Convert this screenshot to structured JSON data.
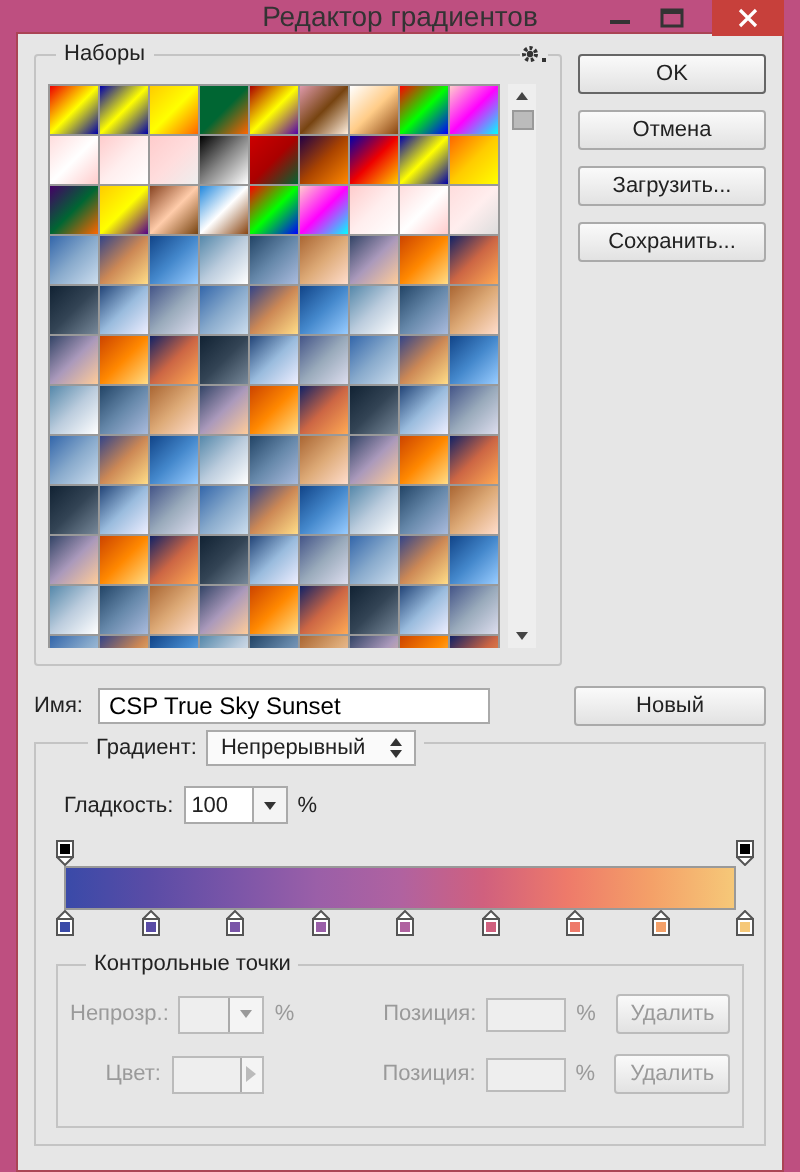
{
  "window": {
    "title": "Редактор градиентов"
  },
  "presets": {
    "label": "Наборы"
  },
  "buttons": [
    {
      "label": "OK",
      "kind": "default"
    },
    {
      "label": "Отмена",
      "kind": "normal"
    },
    {
      "label": "Загрузить...",
      "kind": "normal"
    },
    {
      "label": "Сохранить...",
      "kind": "normal"
    }
  ],
  "name": {
    "label": "Имя:",
    "value": "CSP True Sky Sunset"
  },
  "new_button": "Новый",
  "gradient_type": {
    "label": "Градиент:",
    "value": "Непрерывный"
  },
  "smoothness": {
    "label": "Гладкость:",
    "value": "100",
    "unit": "%"
  },
  "opacity_stops": [
    {
      "color": "#000000"
    },
    {
      "color": "#000000"
    }
  ],
  "color_stops": [
    {
      "color": "#3a4aa8"
    },
    {
      "color": "#5a4ca6"
    },
    {
      "color": "#7a55a8"
    },
    {
      "color": "#9a5fa8"
    },
    {
      "color": "#b062a0"
    },
    {
      "color": "#d0607e"
    },
    {
      "color": "#ee7a6a"
    },
    {
      "color": "#f4a068"
    },
    {
      "color": "#f6c878"
    }
  ],
  "stops": {
    "label": "Контрольные точки",
    "disabled": true,
    "opacity_label": "Непрозр.:",
    "opacity_unit": "%",
    "color_label": "Цвет:",
    "position_label_1": "Позиция:",
    "position_unit_1": "%",
    "delete_1": "Удалить",
    "position_label_2": "Позиция:",
    "position_unit_2": "%",
    "delete_2": "Удалить"
  }
}
